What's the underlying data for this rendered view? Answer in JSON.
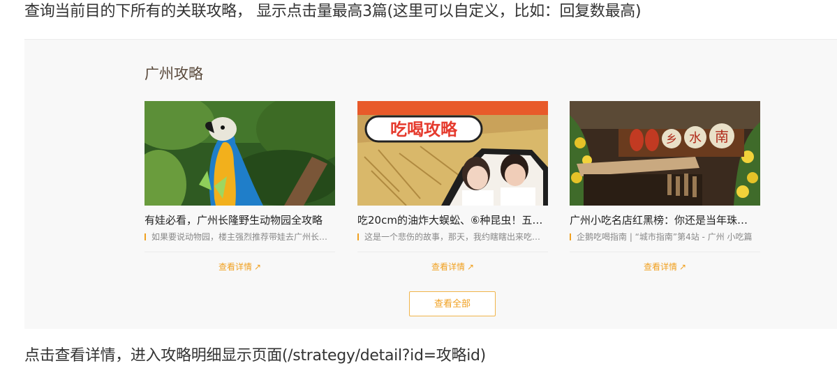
{
  "top_note": "查询当前目的下所有的关联攻略， 显示点击量最高3篇(这里可以自定义，比如：回复数最高)",
  "section": {
    "title": "广州攻略"
  },
  "cards": [
    {
      "image_icon": "parrot-photo",
      "title": "有娃必看，广州长隆野生动物园全攻略",
      "desc": "如果要说动物园，楼主强烈推荐带娃去广州长…",
      "more_label": "查看详情"
    },
    {
      "image_icon": "food-video-photo",
      "image_caption": "吃喝攻略",
      "title": "吃20cm的油炸大蜈蚣、⑥种昆虫！五…",
      "desc": "这是一个悲伤的故事，那天，我约瞎瞎出来吃…",
      "more_label": "查看详情"
    },
    {
      "image_icon": "street-food-shop-photo",
      "image_sign_chars": [
        "乡",
        "水",
        "南"
      ],
      "title": "广州小吃名店红黑榜：你还是当年珠…",
      "desc": "企鹅吃喝指南 | “城市指南”第4站 - 广州 小吃篇",
      "more_label": "查看详情"
    }
  ],
  "view_all_label": "查看全部",
  "bottom_note": "点击查看详情，进入攻略明细显示页面(/strategy/detail?id=攻略id)",
  "colors": {
    "accent": "#f0a020",
    "panel_bg": "#f8f8f8",
    "title_brown": "#5a4a3c"
  }
}
